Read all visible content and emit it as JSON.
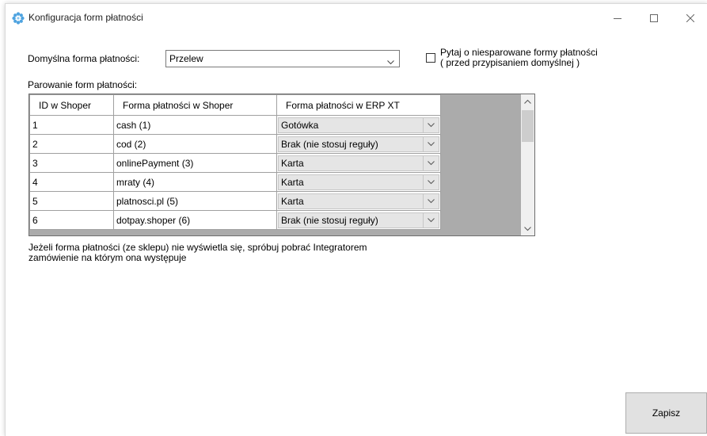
{
  "window": {
    "title": "Konfiguracja form płatności",
    "icon": "gear-flower-icon"
  },
  "default_payment": {
    "label": "Domyślna forma płatności:",
    "value": "Przelew"
  },
  "ask_unpaired": {
    "checked": false,
    "line1": "Pytaj o niesparowane formy płatności",
    "line2": "( przed przypisaniem domyślnej )"
  },
  "pairing": {
    "label": "Parowanie form płatności:",
    "columns": [
      "ID w Shoper",
      "Forma płatności w Shoper",
      "Forma płatności w ERP XT"
    ],
    "rows": [
      {
        "id": "1",
        "shoper": "cash (1)",
        "erp": "Gotówka"
      },
      {
        "id": "2",
        "shoper": "cod (2)",
        "erp": "Brak (nie stosuj reguły)"
      },
      {
        "id": "3",
        "shoper": "onlinePayment (3)",
        "erp": "Karta"
      },
      {
        "id": "4",
        "shoper": "mraty (4)",
        "erp": "Karta"
      },
      {
        "id": "5",
        "shoper": "platnosci.pl (5)",
        "erp": "Karta"
      },
      {
        "id": "6",
        "shoper": "dotpay.shoper (6)",
        "erp": "Brak (nie stosuj reguły)"
      }
    ]
  },
  "info": {
    "line1": "Jeżeli forma płatności (ze sklepu) nie wyświetla się, spróbuj pobrać Integratorem",
    "line2": "zamówienie na którym ona występuje"
  },
  "save_label": "Zapisz"
}
